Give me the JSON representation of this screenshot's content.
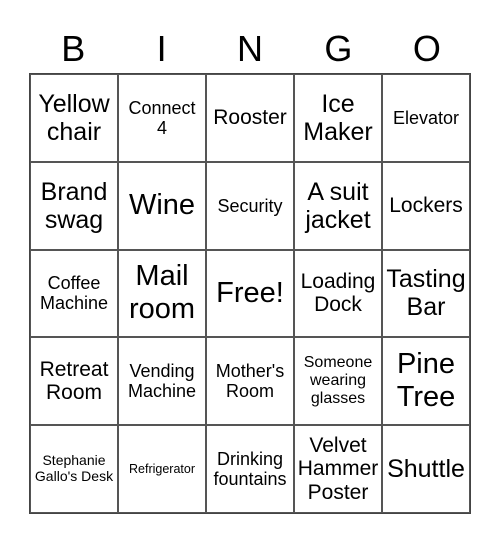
{
  "header": [
    "B",
    "I",
    "N",
    "G",
    "O"
  ],
  "cells": [
    {
      "text": "Yellow chair",
      "size": "l"
    },
    {
      "text": "Connect 4",
      "size": "s"
    },
    {
      "text": "Rooster",
      "size": "m"
    },
    {
      "text": "Ice Maker",
      "size": "l"
    },
    {
      "text": "Elevator",
      "size": "s"
    },
    {
      "text": "Brand swag",
      "size": "l"
    },
    {
      "text": "Wine",
      "size": "xl"
    },
    {
      "text": "Security",
      "size": "s"
    },
    {
      "text": "A suit jacket",
      "size": "l"
    },
    {
      "text": "Lockers",
      "size": "m"
    },
    {
      "text": "Coffee Machine",
      "size": "s"
    },
    {
      "text": "Mail room",
      "size": "xl"
    },
    {
      "text": "Free!",
      "size": "xl"
    },
    {
      "text": "Loading Dock",
      "size": "m"
    },
    {
      "text": "Tasting Bar",
      "size": "l"
    },
    {
      "text": "Retreat Room",
      "size": "m"
    },
    {
      "text": "Vending Machine",
      "size": "s"
    },
    {
      "text": "Mother's Room",
      "size": "s"
    },
    {
      "text": "Someone wearing glasses",
      "size": "xs"
    },
    {
      "text": "Pine Tree",
      "size": "xl"
    },
    {
      "text": "Stephanie Gallo's Desk",
      "size": "xxs"
    },
    {
      "text": "Refrigerator",
      "size": "tiny"
    },
    {
      "text": "Drinking fountains",
      "size": "s"
    },
    {
      "text": "Velvet Hammer Poster",
      "size": "m"
    },
    {
      "text": "Shuttle",
      "size": "l"
    }
  ]
}
